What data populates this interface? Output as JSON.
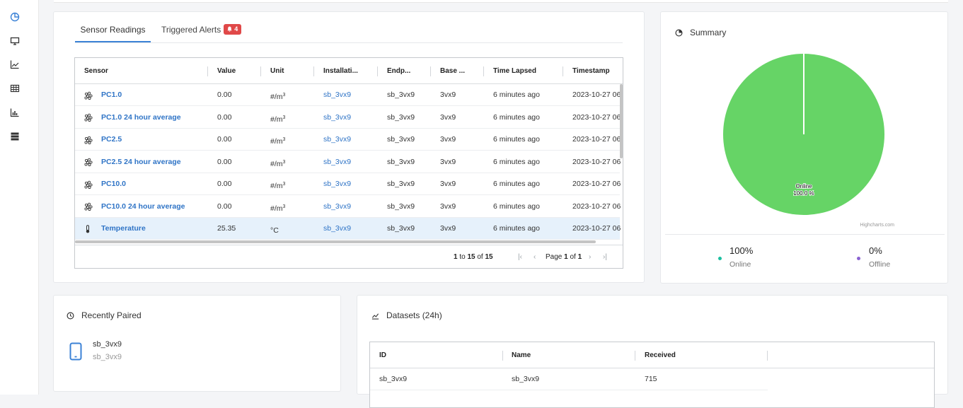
{
  "tabs": [
    {
      "label": "Sensor Readings"
    },
    {
      "label": "Triggered Alerts",
      "badge": "4"
    }
  ],
  "grid": {
    "columns": [
      "Sensor",
      "Value",
      "Unit",
      "Installati...",
      "Endp...",
      "Base ...",
      "Time Lapsed",
      "Timestamp"
    ],
    "rows": [
      {
        "sensor": "PC1.0",
        "value": "0.00",
        "unit": "#/m",
        "unit_sup": "3",
        "installation": "sb_3vx9",
        "endpoint": "sb_3vx9",
        "base": "3vx9",
        "lapsed": "6 minutes ago",
        "timestamp": "2023-10-27 06",
        "icon": "particle-icon"
      },
      {
        "sensor": "PC1.0 24 hour average",
        "value": "0.00",
        "unit": "#/m",
        "unit_sup": "3",
        "installation": "sb_3vx9",
        "endpoint": "sb_3vx9",
        "base": "3vx9",
        "lapsed": "6 minutes ago",
        "timestamp": "2023-10-27 06",
        "icon": "particle-icon"
      },
      {
        "sensor": "PC2.5",
        "value": "0.00",
        "unit": "#/m",
        "unit_sup": "3",
        "installation": "sb_3vx9",
        "endpoint": "sb_3vx9",
        "base": "3vx9",
        "lapsed": "6 minutes ago",
        "timestamp": "2023-10-27 06",
        "icon": "particle-icon"
      },
      {
        "sensor": "PC2.5 24 hour average",
        "value": "0.00",
        "unit": "#/m",
        "unit_sup": "3",
        "installation": "sb_3vx9",
        "endpoint": "sb_3vx9",
        "base": "3vx9",
        "lapsed": "6 minutes ago",
        "timestamp": "2023-10-27 06",
        "icon": "particle-icon"
      },
      {
        "sensor": "PC10.0",
        "value": "0.00",
        "unit": "#/m",
        "unit_sup": "3",
        "installation": "sb_3vx9",
        "endpoint": "sb_3vx9",
        "base": "3vx9",
        "lapsed": "6 minutes ago",
        "timestamp": "2023-10-27 06",
        "icon": "particle-icon"
      },
      {
        "sensor": "PC10.0 24 hour average",
        "value": "0.00",
        "unit": "#/m",
        "unit_sup": "3",
        "installation": "sb_3vx9",
        "endpoint": "sb_3vx9",
        "base": "3vx9",
        "lapsed": "6 minutes ago",
        "timestamp": "2023-10-27 06",
        "icon": "particle-icon"
      },
      {
        "sensor": "Temperature",
        "value": "25.35",
        "unit": "°C",
        "unit_sup": "",
        "installation": "sb_3vx9",
        "endpoint": "sb_3vx9",
        "base": "3vx9",
        "lapsed": "6 minutes ago",
        "timestamp": "2023-10-27 06",
        "icon": "thermometer-icon"
      }
    ],
    "pager": {
      "from": "1",
      "to_word": "to",
      "to": "15",
      "of_word": "of",
      "total": "15",
      "page_word": "Page",
      "page": "1",
      "of_word2": "of",
      "pages": "1"
    }
  },
  "summary": {
    "title": "Summary",
    "pie_label": "Online",
    "pie_pct": "100.0 %",
    "credits": "Highcharts.com",
    "online_value": "100%",
    "online_label": "Online",
    "offline_value": "0%",
    "offline_label": "Offline"
  },
  "chart_data": {
    "type": "pie",
    "series": [
      {
        "name": "Online",
        "value": 100.0
      },
      {
        "name": "Offline",
        "value": 0.0
      }
    ]
  },
  "recent": {
    "title": "Recently Paired",
    "device_name": "sb_3vx9",
    "device_sub": "sb_3vx9"
  },
  "datasets": {
    "title": "Datasets (24h)",
    "columns": [
      "ID",
      "Name",
      "Received"
    ],
    "rows": [
      {
        "id": "sb_3vx9",
        "name": "sb_3vx9",
        "received": "715"
      }
    ]
  },
  "colors": {
    "accent": "#3b82d6",
    "pie": "#66d466",
    "online_dot": "#1bbfa0",
    "offline_dot": "#8a63d2",
    "badge": "#e04848"
  }
}
